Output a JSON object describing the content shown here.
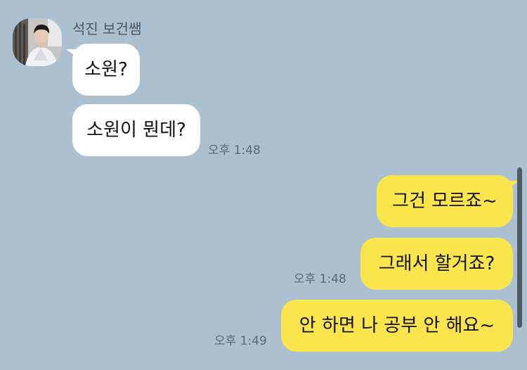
{
  "contact": {
    "name": "석진 보건쌤",
    "avatar_icon": "profile-photo"
  },
  "messages": [
    {
      "from": "them",
      "text": "소원?"
    },
    {
      "from": "them",
      "text": "소원이 뭔데?",
      "time": "오후 1:48"
    },
    {
      "from": "me",
      "text": "그건 모르죠~"
    },
    {
      "from": "me",
      "text": "그래서 할거죠?",
      "time": "오후 1:48"
    },
    {
      "from": "me",
      "text": "안 하면 나 공부 안 해요~",
      "time": "오후 1:49"
    }
  ],
  "colors": {
    "background": "#abc1d1",
    "incoming_bubble": "#ffffff",
    "outgoing_bubble": "#fbe54d",
    "timestamp": "#5b6772"
  }
}
